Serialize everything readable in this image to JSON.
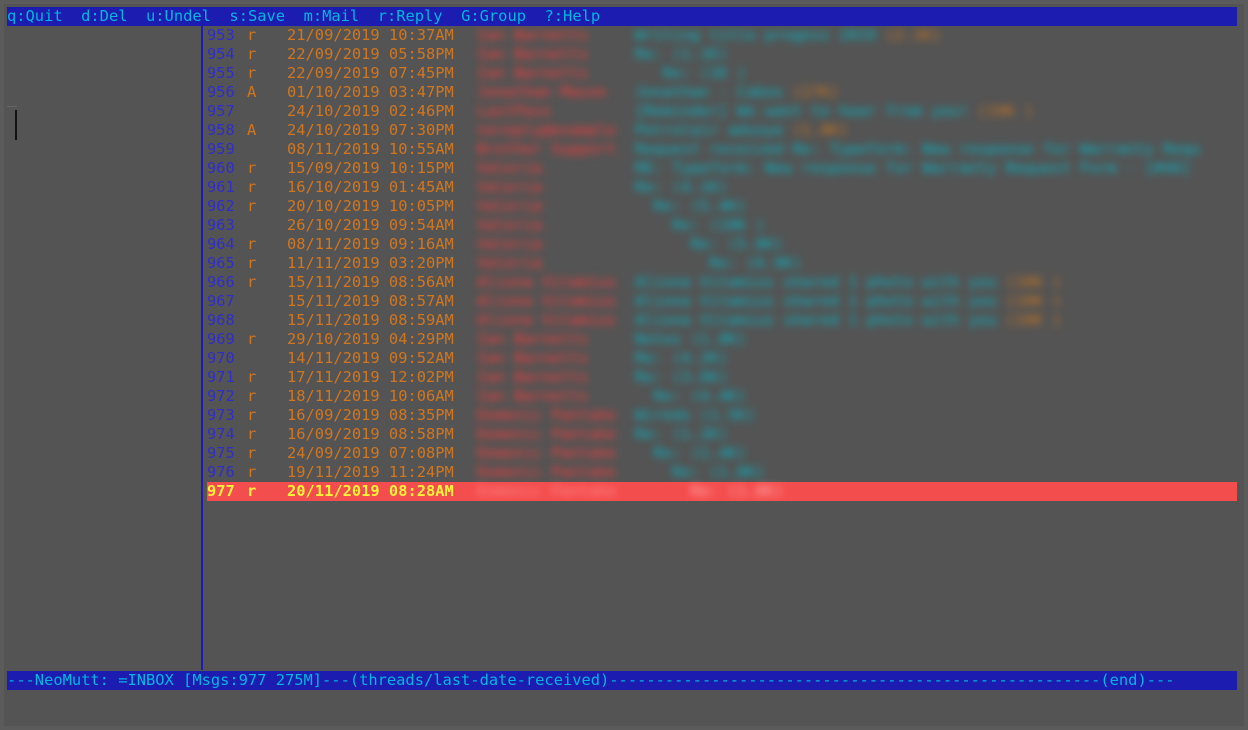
{
  "help_bar": [
    {
      "key": "q",
      "label": "q:Quit"
    },
    {
      "key": "d",
      "label": "d:Del"
    },
    {
      "key": "u",
      "label": "u:Undel"
    },
    {
      "key": "s",
      "label": "s:Save"
    },
    {
      "key": "m",
      "label": "m:Mail"
    },
    {
      "key": "r",
      "label": "r:Reply"
    },
    {
      "key": "G",
      "label": "G:Group"
    },
    {
      "key": "?",
      "label": "?:Help"
    }
  ],
  "messages": [
    {
      "num": "953",
      "flag": "r",
      "date": "21/09/2019 10:37AM",
      "from": "Ian Barnetts",
      "subject": "Writing title progess 2019",
      "size": "(2.1K)"
    },
    {
      "num": "954",
      "flag": "r",
      "date": "22/09/2019 05:58PM",
      "from": "Ian Barnetts",
      "subject": "Re: (1.1K)",
      "size": ""
    },
    {
      "num": "955",
      "flag": "r",
      "date": "22/09/2019 07:45PM",
      "from": "Ian Barnetts",
      "subject": "   Re: (1K )",
      "size": ""
    },
    {
      "num": "956",
      "flag": "A",
      "date": "01/10/2019 03:47PM",
      "from": "Jonathan Mason",
      "subject": "Jonathan - Cabos",
      "size": "(27K)"
    },
    {
      "num": "957",
      "flag": "",
      "date": "24/10/2019 02:46PM",
      "from": "LastPass",
      "subject": "[Reminder] We want to hear from you!",
      "size": "(19K )"
    },
    {
      "num": "958",
      "flag": "A",
      "date": "24/10/2019 07:30PM",
      "from": "noreply@example",
      "subject": "Petrolair adsoye",
      "size": "(1.8K)"
    },
    {
      "num": "959",
      "flag": "",
      "date": "08/11/2019 10:55AM",
      "from": "Brother Support",
      "subject": "Request received Re: Typeform: New response for Warranty Requ",
      "size": ""
    },
    {
      "num": "960",
      "flag": "r",
      "date": "15/09/2019 10:15PM",
      "from": "Valeria",
      "subject": "RE: Typeform: New response for Warranty Request Form - [#46]",
      "size": ""
    },
    {
      "num": "961",
      "flag": "r",
      "date": "16/10/2019 01:45AM",
      "from": "Valeria",
      "subject": "Re: (4.1K)",
      "size": ""
    },
    {
      "num": "962",
      "flag": "r",
      "date": "20/10/2019 10:05PM",
      "from": "Valeria",
      "subject": "  Re: (5.4K)",
      "size": ""
    },
    {
      "num": "963",
      "flag": "",
      "date": "26/10/2019 09:54AM",
      "from": "Valeria",
      "subject": "    Re: (10K )",
      "size": ""
    },
    {
      "num": "964",
      "flag": "r",
      "date": "08/11/2019 09:16AM",
      "from": "Valeria",
      "subject": "      Re: (5.8K)",
      "size": ""
    },
    {
      "num": "965",
      "flag": "r",
      "date": "11/11/2019 03:20PM",
      "from": "Valeria",
      "subject": "        Re: (6.9K)",
      "size": ""
    },
    {
      "num": "966",
      "flag": "r",
      "date": "15/11/2019 08:56AM",
      "from": "Aliona Vitamius",
      "subject": "Aliona Vitamius shared 1 photo with you",
      "size": "(10K )"
    },
    {
      "num": "967",
      "flag": "",
      "date": "15/11/2019 08:57AM",
      "from": "Aliona Vitamius",
      "subject": "Aliona Vitamius shared 1 photo with you",
      "size": "(10K )"
    },
    {
      "num": "968",
      "flag": "",
      "date": "15/11/2019 08:59AM",
      "from": "Aliona Vitamius",
      "subject": "Aliona Vitamius shared 1 photo with you",
      "size": "(10K )"
    },
    {
      "num": "969",
      "flag": "r",
      "date": "29/10/2019 04:29PM",
      "from": "Ian Barnetts",
      "subject": "Notes (1.8K)",
      "size": ""
    },
    {
      "num": "970",
      "flag": "",
      "date": "14/11/2019 09:52AM",
      "from": "Ian Barnetts",
      "subject": "Re: (4.2K)",
      "size": ""
    },
    {
      "num": "971",
      "flag": "r",
      "date": "17/11/2019 12:02PM",
      "from": "Ian Barnetts",
      "subject": "Re: (3.6K)",
      "size": ""
    },
    {
      "num": "972",
      "flag": "r",
      "date": "18/11/2019 10:06AM",
      "from": "Ian Barnetts",
      "subject": "  Re: (4.4K)",
      "size": ""
    },
    {
      "num": "973",
      "flag": "r",
      "date": "16/09/2019 08:35PM",
      "from": "Domenic Pantake",
      "subject": "Wiredo (1.5K)",
      "size": ""
    },
    {
      "num": "974",
      "flag": "r",
      "date": "16/09/2019 08:58PM",
      "from": "Domenic Pantake",
      "subject": "Re: (1.2K)",
      "size": ""
    },
    {
      "num": "975",
      "flag": "r",
      "date": "24/09/2019 07:08PM",
      "from": "Domenic Pantake",
      "subject": "  Re: (1.4K)",
      "size": ""
    },
    {
      "num": "976",
      "flag": "r",
      "date": "19/11/2019 11:24PM",
      "from": "Domenic Pantake",
      "subject": "    Re: (1.8K)",
      "size": ""
    },
    {
      "num": "977",
      "flag": "r",
      "date": "20/11/2019 08:28AM",
      "from": "Domenic Pantake",
      "subject": "      Re: (1.8K)",
      "size": "",
      "selected": true
    }
  ],
  "status_bar": {
    "text": "---NeoMutt: =INBOX [Msgs:977 275M]---(threads/last-date-received)-----------------------------------------------------(end)---"
  }
}
